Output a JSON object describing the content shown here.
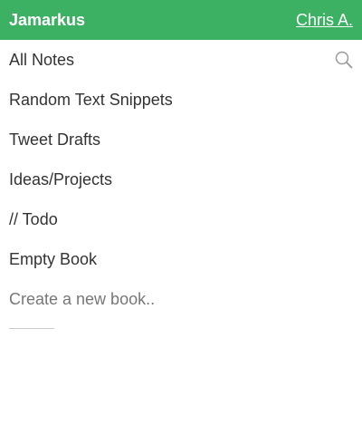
{
  "header": {
    "title": "Jamarkus",
    "user": "Chris A.",
    "background_color": "#3cb063"
  },
  "books": [
    {
      "label": "All Notes"
    },
    {
      "label": "Random Text Snippets"
    },
    {
      "label": "Tweet Drafts"
    },
    {
      "label": "Ideas/Projects"
    },
    {
      "label": "// Todo"
    },
    {
      "label": "Empty Book"
    }
  ],
  "new_book": {
    "label": "Create a new book.."
  },
  "icons": {
    "search": "search-icon"
  }
}
